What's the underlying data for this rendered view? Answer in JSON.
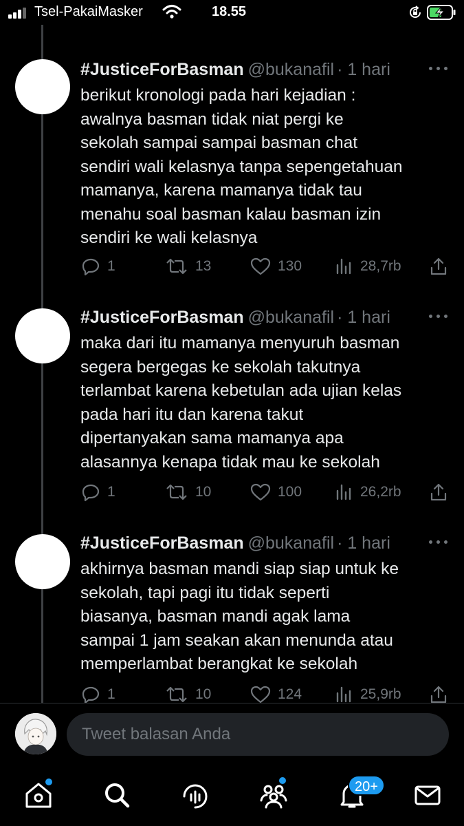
{
  "status_bar": {
    "carrier": "Tsel-PakaiMasker",
    "time": "18.55"
  },
  "tweets": [
    {
      "name": "#JusticeForBasman",
      "handle": "@bukanafil",
      "time": "· 1 hari",
      "text": "berikut kronologi pada hari kejadian :\nawalnya basman tidak niat pergi ke sekolah sampai sampai basman chat sendiri wali kelasnya tanpa sepengetahuan mamanya, karena mamanya tidak tau menahu soal basman kalau basman izin sendiri ke wali kelasnya",
      "replies": "1",
      "retweets": "13",
      "likes": "130",
      "views": "28,7rb"
    },
    {
      "name": "#JusticeForBasman",
      "handle": "@bukanafil",
      "time": "· 1 hari",
      "text": "maka dari itu mamanya menyuruh basman segera bergegas ke sekolah takutnya terlambat karena kebetulan ada ujian kelas pada hari itu dan karena takut dipertanyakan sama mamanya apa alasannya kenapa tidak mau ke sekolah",
      "replies": "1",
      "retweets": "10",
      "likes": "100",
      "views": "26,2rb"
    },
    {
      "name": "#JusticeForBasman",
      "handle": "@bukanafil",
      "time": "· 1 hari",
      "text": "akhirnya basman mandi siap siap untuk ke sekolah, tapi pagi itu tidak seperti biasanya, basman mandi agak lama sampai 1 jam seakan akan menunda atau memperlambat berangkat ke sekolah",
      "replies": "1",
      "retweets": "10",
      "likes": "124",
      "views": "25,9rb"
    }
  ],
  "reply_bar": {
    "placeholder": "Tweet balasan Anda"
  },
  "tab_bar": {
    "notifications_badge": "20+",
    "tabs": [
      "home-icon",
      "search-icon",
      "spaces-icon",
      "communities-icon",
      "notifications-icon",
      "messages-icon"
    ]
  },
  "colors": {
    "background": "#000000",
    "text": "#e7e9ea",
    "muted": "#71767b",
    "accent": "#1d9bf0",
    "battery": "#4cd964"
  }
}
